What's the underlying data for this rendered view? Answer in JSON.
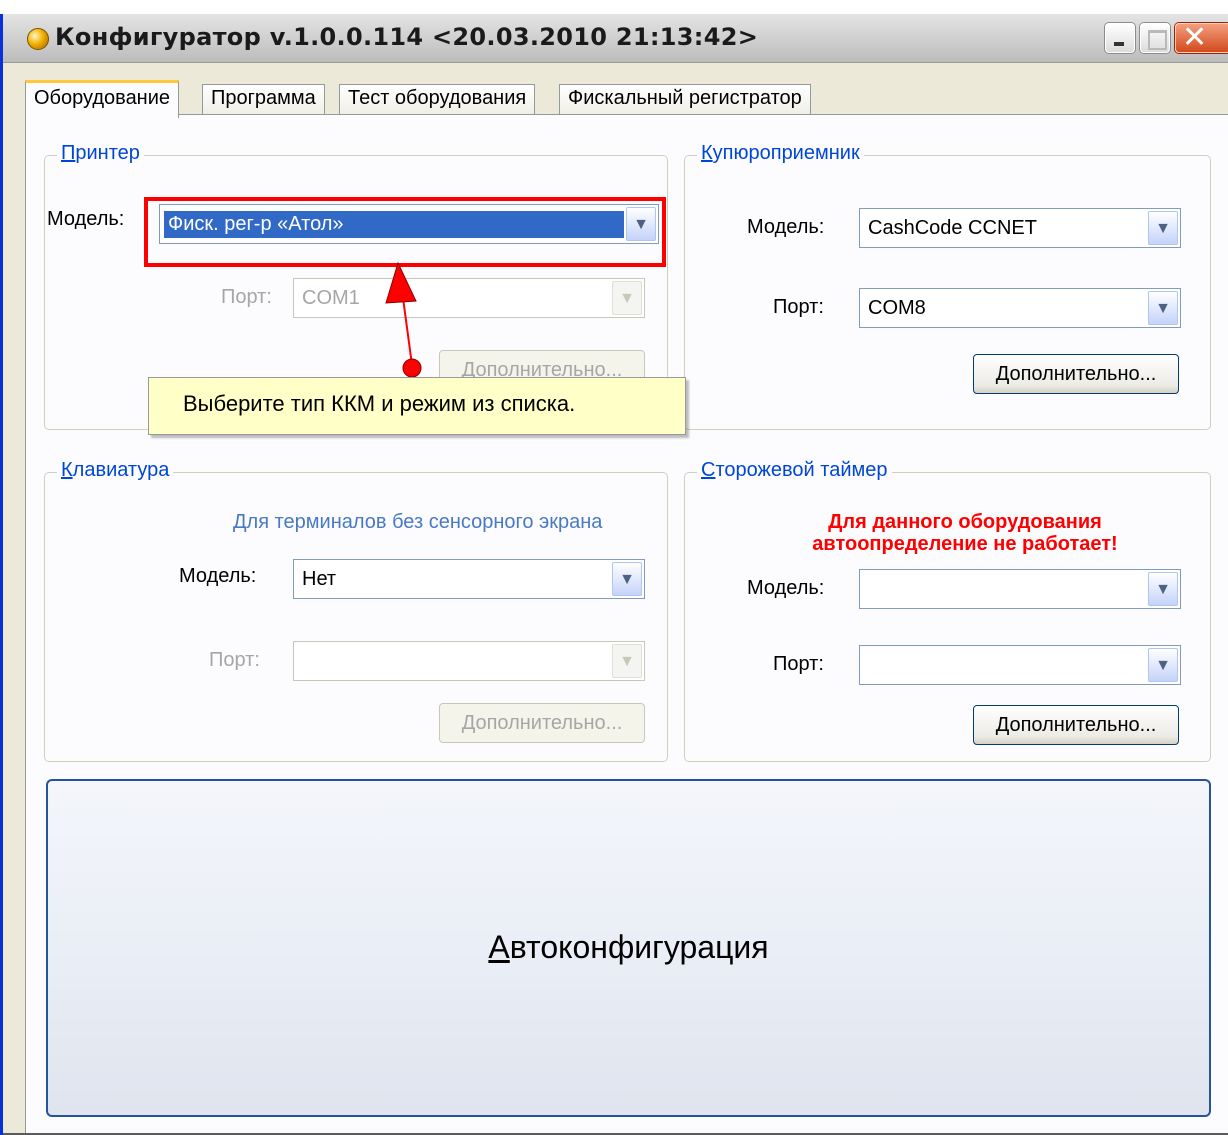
{
  "window": {
    "title": "Конфигуратор v.1.0.0.114 <20.03.2010 21:13:42>"
  },
  "tabs": [
    {
      "label": "Оборудование",
      "active": true
    },
    {
      "label": "Программа"
    },
    {
      "label": "Тест оборудования"
    },
    {
      "label": "Фискальный регистратор"
    }
  ],
  "printer": {
    "legend": "Принтер",
    "model_label": "Модель:",
    "model_value": "Фиск. рег-р «Атол»",
    "port_label": "Порт:",
    "port_value": "COM1",
    "more_button": "Дополнительно..."
  },
  "bill_acceptor": {
    "legend": "Купюроприемник",
    "model_label": "Модель:",
    "model_value": "CashCode CCNET",
    "port_label": "Порт:",
    "port_value": "COM8",
    "more_button": "Дополнительно..."
  },
  "keyboard": {
    "legend": "Клавиатура",
    "note": "Для терминалов без сенсорного экрана",
    "model_label": "Модель:",
    "model_value": "Нет",
    "port_label": "Порт:",
    "port_value": "",
    "more_button": "Дополнительно..."
  },
  "watchdog": {
    "legend": "Сторожевой таймер",
    "warning_line1": "Для данного оборудования",
    "warning_line2": "автоопределение не работает!",
    "model_label": "Модель:",
    "model_value": "",
    "port_label": "Порт:",
    "port_value": "",
    "more_button": "Дополнительно..."
  },
  "autoconfig_button": "Автоконфигурация",
  "tooltip": "Выберите тип ККМ и режим из списка.",
  "colors": {
    "accent": "#0046d5",
    "highlight": "#ff0000",
    "warning": "#ff0000",
    "tooltip_bg": "#ffffc8"
  }
}
